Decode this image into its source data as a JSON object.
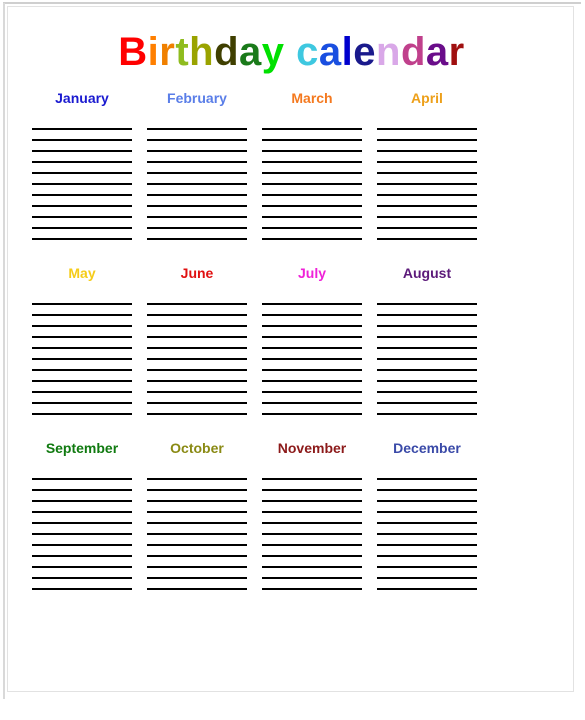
{
  "document": {
    "title": "Birthday calendar",
    "background_color": "#ffffff",
    "page_border_color": "#e2e2e2"
  },
  "title": {
    "text": "Birthday calendar",
    "letters": [
      {
        "char": "B",
        "color": "#ff0000"
      },
      {
        "char": "i",
        "color": "#ff7f00"
      },
      {
        "char": "r",
        "color": "#f08000"
      },
      {
        "char": "t",
        "color": "#8fbc1f"
      },
      {
        "char": "h",
        "color": "#9aa300"
      },
      {
        "char": "d",
        "color": "#3f3f00"
      },
      {
        "char": "a",
        "color": "#1a7a1a"
      },
      {
        "char": "y",
        "color": "#00e000"
      },
      {
        "char": " ",
        "color": "#000000"
      },
      {
        "char": "c",
        "color": "#3ec8e0"
      },
      {
        "char": "a",
        "color": "#1a4fe0"
      },
      {
        "char": "l",
        "color": "#0000cd"
      },
      {
        "char": "e",
        "color": "#1a1a8c"
      },
      {
        "char": "n",
        "color": "#d9a8e8"
      },
      {
        "char": "d",
        "color": "#c0408c"
      },
      {
        "char": "a",
        "color": "#6a0d8a"
      },
      {
        "char": "r",
        "color": "#a01010"
      }
    ]
  },
  "calendar": {
    "lines_per_month": 11,
    "line_color": "#000000",
    "rows": [
      {
        "months": [
          {
            "name": "January",
            "color": "#1a1ad0"
          },
          {
            "name": "February",
            "color": "#5a7ee8"
          },
          {
            "name": "March",
            "color": "#f4791f"
          },
          {
            "name": "April",
            "color": "#eda01a"
          }
        ]
      },
      {
        "months": [
          {
            "name": "May",
            "color": "#f5cc1a"
          },
          {
            "name": "June",
            "color": "#e01010"
          },
          {
            "name": "July",
            "color": "#ef21d8"
          },
          {
            "name": "August",
            "color": "#5c1a7a"
          }
        ]
      },
      {
        "months": [
          {
            "name": "September",
            "color": "#107a10"
          },
          {
            "name": "October",
            "color": "#8a8a14"
          },
          {
            "name": "November",
            "color": "#8c1a1a"
          },
          {
            "name": "December",
            "color": "#3a4aa8"
          }
        ]
      }
    ]
  }
}
